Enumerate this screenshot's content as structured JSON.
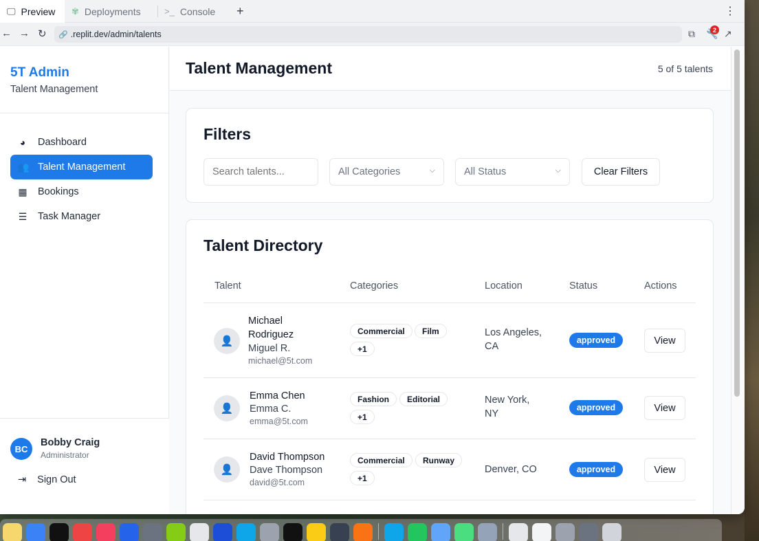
{
  "browser": {
    "tabs": [
      {
        "label": "Preview",
        "icon": "monitor-icon",
        "active": true
      },
      {
        "label": "Deployments",
        "icon": "deploy-icon",
        "active": false
      },
      {
        "label": "Console",
        "icon": "terminal-icon",
        "active": false
      }
    ],
    "new_tab": "+",
    "url": ".replit.dev/admin/talents",
    "notification_count": "2"
  },
  "sidebar": {
    "brand": "5T Admin",
    "subtitle": "Talent Management",
    "items": [
      {
        "label": "Dashboard",
        "icon": "palette-icon",
        "active": false
      },
      {
        "label": "Talent Management",
        "icon": "users-icon",
        "active": true
      },
      {
        "label": "Bookings",
        "icon": "calendar-icon",
        "active": false
      },
      {
        "label": "Task Manager",
        "icon": "tasks-icon",
        "active": false
      }
    ],
    "user": {
      "initials": "BC",
      "name": "Bobby Craig",
      "role": "Administrator"
    },
    "sign_out": "Sign Out"
  },
  "header": {
    "title": "Talent Management",
    "count": "5 of 5 talents"
  },
  "filters": {
    "title": "Filters",
    "search_placeholder": "Search talents...",
    "category": "All Categories",
    "status": "All Status",
    "clear": "Clear Filters"
  },
  "directory": {
    "title": "Talent Directory",
    "columns": [
      "Talent",
      "Categories",
      "Location",
      "Status",
      "Actions"
    ],
    "rows": [
      {
        "name_line1": "Michael",
        "name_line2": "Rodriguez",
        "alias": "Miguel R.",
        "email": "michael@5t.com",
        "categories": [
          "Commercial",
          "Film",
          "+1"
        ],
        "location_line1": "Los Angeles,",
        "location_line2": "CA",
        "status": "approved",
        "action": "View"
      },
      {
        "name_line1": "Emma Chen",
        "alias": "Emma C.",
        "email": "emma@5t.com",
        "categories": [
          "Fashion",
          "Editorial",
          "+1"
        ],
        "location_line1": "New York,",
        "location_line2": "NY",
        "status": "approved",
        "action": "View"
      },
      {
        "name_line1": "David Thompson",
        "alias": "Dave Thompson",
        "email": "david@5t.com",
        "categories": [
          "Commercial",
          "Runway",
          "+1"
        ],
        "location_line1": "Denver, CO",
        "status": "approved",
        "action": "View"
      }
    ]
  },
  "colors": {
    "accent": "#1d7ae8",
    "text": "#111827",
    "muted": "#6b7280",
    "border": "#e5e7eb"
  }
}
